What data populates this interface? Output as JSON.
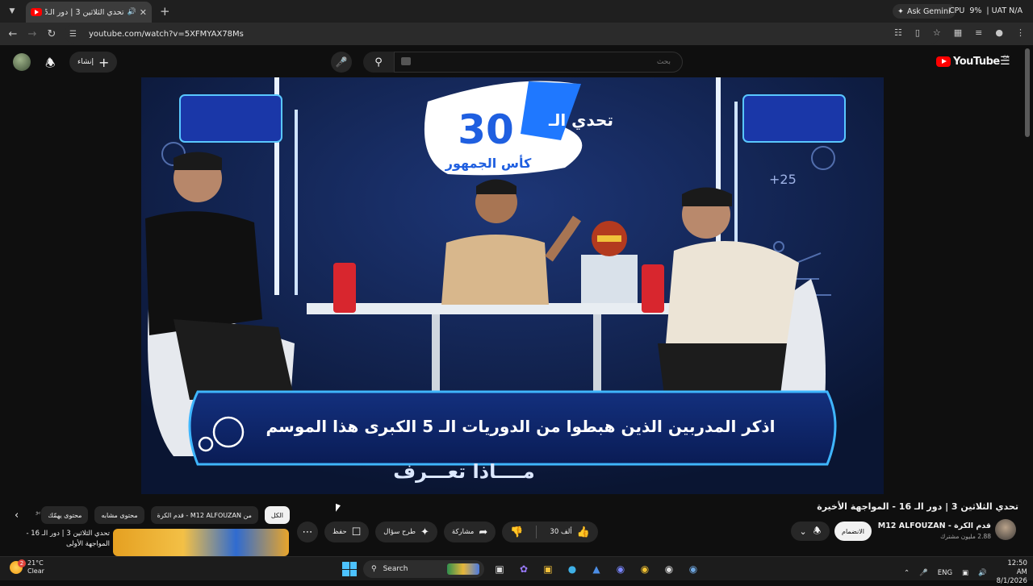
{
  "browser": {
    "tab": {
      "title": "تحدي الثلاثين 3 | دور الـ16 - ا",
      "audio_icon": "speaker-icon"
    },
    "new_tab": "+",
    "ask_gemini": "Ask Gemini",
    "cpu_label": "CPU",
    "cpu_value": "9%",
    "status_extra": "| UAT N/A",
    "url": "youtube.com/watch?v=5XFMYAX78Ms"
  },
  "youtube": {
    "create_label": "إنشاء",
    "search_placeholder": "بحث",
    "logo_text": "YouTube",
    "logo_region": "CA"
  },
  "video": {
    "logo_text": "تحدي الـ",
    "logo_number": "30",
    "logo_subtitle": "كأس الجمهور",
    "question": "اذكر المدربين الذين هبطوا من الدوريات الـ 5 الكبرى هذا الموسم",
    "hint": "مــــاذا تعـــرف",
    "score_plus": "+25"
  },
  "chips": [
    {
      "label": "الكل",
      "active": true
    },
    {
      "label": "من M12 ALFOUZAN - قدم الكرة",
      "active": false
    },
    {
      "label": "محتوى مشابه",
      "active": false
    },
    {
      "label": "محتوى يهمّك",
      "active": false
    }
  ],
  "chips_overflow": "فيديو",
  "related": {
    "title": "تحدي الثلاثين 3 | دور الـ 16 - المواجهة الأولى"
  },
  "watch": {
    "title": "تحدي الثلاثين 3 | دور الـ 16 - المواجهة الأخيرة",
    "channel_name": "قدم الكرة - M12 ALFOUZAN",
    "subscribers": "2.88 مليون مشترك",
    "join_label": "الانضمام",
    "likes": "30 ألف",
    "share_label": "مشاركة",
    "ask_label": "طرح سؤال",
    "save_label": "حفظ"
  },
  "taskbar": {
    "temperature": "21°C",
    "weather": "Clear",
    "weather_badge": "2",
    "search_label": "Search",
    "language": "ENG",
    "time": "12:50 AM",
    "date": "8/1/2026"
  },
  "colors": {
    "yt_red": "#ff0000",
    "accent_blue": "#1f78ff",
    "card_glow": "#3fb6ff"
  }
}
